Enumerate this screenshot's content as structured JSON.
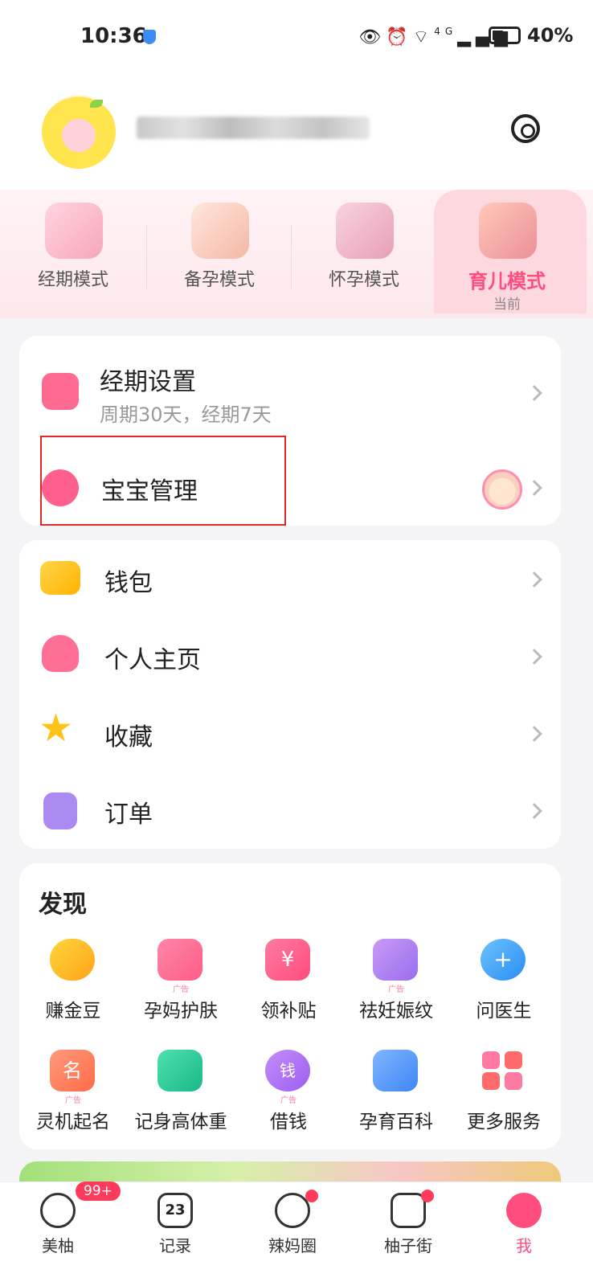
{
  "status_bar": {
    "time": "10:36",
    "battery": "40%",
    "network": "4G"
  },
  "modes": [
    {
      "label": "经期模式"
    },
    {
      "label": "备孕模式"
    },
    {
      "label": "怀孕模式"
    },
    {
      "label": "育儿模式",
      "sub": "当前"
    }
  ],
  "period_settings": {
    "title": "经期设置",
    "subtitle": "周期30天，经期7天"
  },
  "baby_manage": {
    "title": "宝宝管理"
  },
  "menu": [
    {
      "label": "钱包"
    },
    {
      "label": "个人主页"
    },
    {
      "label": "收藏"
    },
    {
      "label": "订单"
    }
  ],
  "discover": {
    "title": "发现",
    "items": [
      {
        "label": "赚金豆",
        "ad": ""
      },
      {
        "label": "孕妈护肤",
        "ad": "广告"
      },
      {
        "label": "领补贴",
        "ad": ""
      },
      {
        "label": "祛妊娠纹",
        "ad": "广告"
      },
      {
        "label": "问医生",
        "ad": ""
      },
      {
        "label": "灵机起名",
        "ad": "广告"
      },
      {
        "label": "记身高体重",
        "ad": ""
      },
      {
        "label": "借钱",
        "ad": "广告"
      },
      {
        "label": "孕育百科",
        "ad": ""
      },
      {
        "label": "更多服务",
        "ad": ""
      }
    ]
  },
  "bottom_nav": [
    {
      "label": "美柚",
      "badge": "99+"
    },
    {
      "label": "记录",
      "icon_text": "23"
    },
    {
      "label": "辣妈圈"
    },
    {
      "label": "柚子街"
    },
    {
      "label": "我"
    }
  ],
  "colors": {
    "accent": "#ff4d7d",
    "highlight_box": "#e02a2a"
  }
}
